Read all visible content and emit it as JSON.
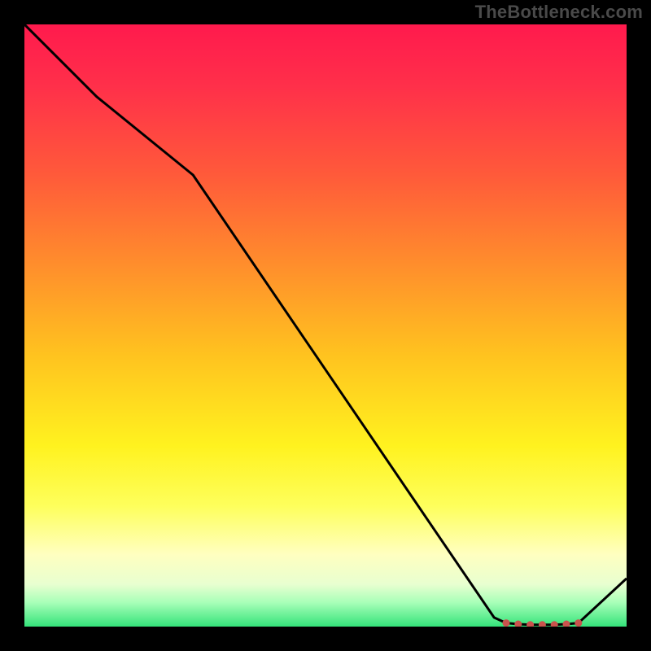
{
  "watermark": "TheBottleneck.com",
  "chart_data": {
    "type": "line",
    "title": "",
    "xlabel": "",
    "ylabel": "",
    "xlim": [
      0,
      100
    ],
    "ylim": [
      0,
      100
    ],
    "grid": false,
    "legend": false,
    "series": [
      {
        "name": "bottleneck-curve",
        "x": [
          0,
          12,
          28,
          78,
          80,
          82,
          84,
          86,
          88,
          90,
          92,
          100
        ],
        "y": [
          100,
          88,
          75,
          1.5,
          0.6,
          0.4,
          0.3,
          0.3,
          0.3,
          0.4,
          0.6,
          8
        ],
        "stroke": "#000000",
        "stroke_width": 3
      }
    ],
    "markers": {
      "name": "highlight-dots",
      "color": "#c9534d",
      "radius": 4.5,
      "points": [
        {
          "x": 80,
          "y": 0.6
        },
        {
          "x": 82,
          "y": 0.4
        },
        {
          "x": 84,
          "y": 0.3
        },
        {
          "x": 86,
          "y": 0.3
        },
        {
          "x": 88,
          "y": 0.3
        },
        {
          "x": 90,
          "y": 0.4
        },
        {
          "x": 92,
          "y": 0.6
        }
      ]
    },
    "background_gradient": {
      "direction": "top-to-bottom",
      "stops": [
        {
          "pos": 0,
          "color": "#ff1a4d"
        },
        {
          "pos": 25,
          "color": "#ff5a3a"
        },
        {
          "pos": 55,
          "color": "#ffc31f"
        },
        {
          "pos": 80,
          "color": "#feff5c"
        },
        {
          "pos": 100,
          "color": "#34e37a"
        }
      ]
    }
  }
}
